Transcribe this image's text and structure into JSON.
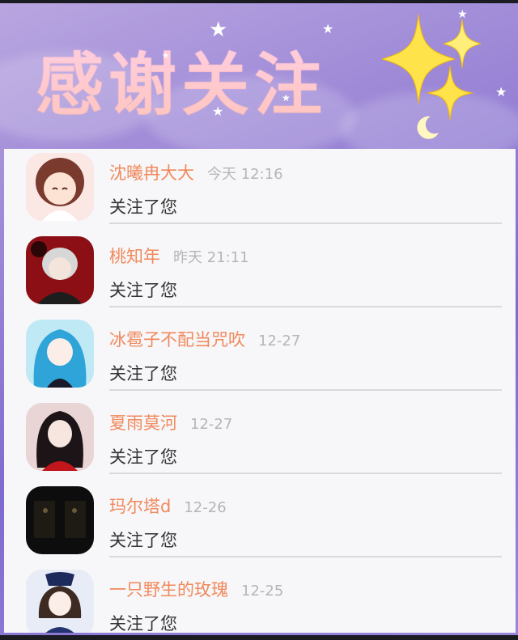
{
  "banner": {
    "title": "感谢关注"
  },
  "followers": [
    {
      "name": "沈曦冉大大",
      "time": "今天 12:16",
      "message": "关注了您"
    },
    {
      "name": "桃知年",
      "time": "昨天 21:11",
      "message": "关注了您"
    },
    {
      "name": "冰雹子不配当咒吹",
      "time": "12-27",
      "message": "关注了您"
    },
    {
      "name": "夏雨莫河",
      "time": "12-27",
      "message": "关注了您"
    },
    {
      "name": "玛尔塔d",
      "time": "12-26",
      "message": "关注了您"
    },
    {
      "name": "一只野生的玫瑰",
      "time": "12-25",
      "message": "关注了您"
    }
  ],
  "colors": {
    "name": "#f0895c",
    "time": "#b5b5ba",
    "message": "#333333",
    "divider": "#d9d9de",
    "panel_bg": "#f7f6f8",
    "banner_purple": "#9b86d6"
  },
  "icons": [
    "sparkle-icon",
    "moon-icon",
    "star-icon"
  ]
}
